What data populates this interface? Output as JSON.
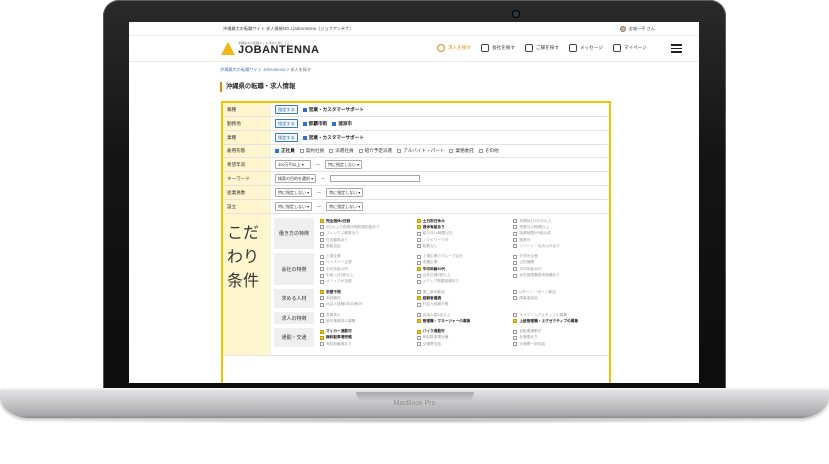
{
  "laptop": {
    "brand": "MacBook Pro"
  },
  "topbar": {
    "tagline": "沖縄最大の転職サイト 求人情報NO.1|JobAntenna（ジョブアンテナ）",
    "user_name": "金城一平 さん"
  },
  "header": {
    "logo_tag": "沖縄最大の転職サイト あなた探してる…",
    "logo_name": "JOBANTENNA",
    "nav": [
      {
        "label": "求人を探す",
        "icon": "search-icon",
        "active": true
      },
      {
        "label": "会社を探す",
        "icon": "building-icon",
        "active": false
      },
      {
        "label": "ご縁を探す",
        "icon": "handshake-icon",
        "active": false
      },
      {
        "label": "メッセージ",
        "icon": "message-icon",
        "active": false
      },
      {
        "label": "マイページ",
        "icon": "mypage-icon",
        "active": false
      }
    ]
  },
  "breadcrumb": {
    "home": "沖縄最大の転職サイト JobAntenna",
    "separator": ">",
    "current": "求人を探す"
  },
  "title": "沖縄県の転職・求人情報",
  "form": {
    "pick_label": "指定する",
    "rows": {
      "shokushu": {
        "label": "職種",
        "checks": [
          "営業・カスタマーサポート"
        ]
      },
      "kinmuchi": {
        "label": "勤務地",
        "checks": [
          "那覇市街",
          "浦添市"
        ]
      },
      "gyoshu": {
        "label": "業種",
        "checks": [
          "営業・カスタマーサポート"
        ]
      },
      "koyo": {
        "label": "雇用形態",
        "options": [
          "正社員",
          "契約社員",
          "派遣社員",
          "紹介予定派遣",
          "アルバイト・パート",
          "業務委託",
          "その他"
        ],
        "checked": [
          0
        ]
      },
      "nenshu": {
        "label": "希望年収",
        "from": "300万円以上",
        "tilde": "〜",
        "to": "特に指定しない"
      },
      "keyword": {
        "label": "キーワード",
        "scope": "検索の目的を選択",
        "tilde": "〜"
      },
      "jugyoin": {
        "label": "従業員数",
        "from": "特に指定しない",
        "tilde": "〜",
        "to": "特に指定しない"
      },
      "setsuritsu": {
        "label": "設立",
        "from": "特に指定しない",
        "tilde": "〜",
        "to": "特に指定しない"
      }
    },
    "kodawari": {
      "label": "こだわり条件",
      "groups": [
        {
          "label": "働き方の特徴",
          "options": [
            {
              "text": "完全週休2日制",
              "on": true
            },
            {
              "text": "土日祝日休み",
              "on": true
            },
            {
              "text": "年間休日120日以上",
              "on": false
            },
            {
              "text": "5日以上の長期休暇取得制度あり",
              "on": false
            },
            {
              "text": "週休有給あり",
              "on": true
            },
            {
              "text": "残業月10時間以上",
              "on": false
            },
            {
              "text": "フレックス勤務あり",
              "on": false
            },
            {
              "text": "給与月10時間以内",
              "on": false
            },
            {
              "text": "始業時間が9時以前",
              "on": false
            },
            {
              "text": "在宅勤務あり",
              "on": false
            },
            {
              "text": "ノマドワーク可",
              "on": false
            },
            {
              "text": "副業可",
              "on": false
            },
            {
              "text": "服装自由",
              "on": false
            },
            {
              "text": "転勤なし",
              "on": false
            },
            {
              "text": "リゾート・住み込みあり",
              "on": false
            }
          ]
        },
        {
          "label": "会社の特徴",
          "options": [
            {
              "text": "上場企業",
              "on": false
            },
            {
              "text": "上場企業のグループ会社",
              "on": false
            },
            {
              "text": "外資系企業",
              "on": false
            },
            {
              "text": "ベンチャー企業",
              "on": false
            },
            {
              "text": "老舗企業",
              "on": false
            },
            {
              "text": "公的機関",
              "on": false
            },
            {
              "text": "平均年齢20代",
              "on": false
            },
            {
              "text": "平均年齢30代",
              "on": true
            },
            {
              "text": "平均年齢40代",
              "on": false
            },
            {
              "text": "中途入社5割以上",
              "on": false
            },
            {
              "text": "女性社員5割以上",
              "on": false
            },
            {
              "text": "女性管理職登用実績あり",
              "on": false
            },
            {
              "text": "オフィスが自慢",
              "on": false
            },
            {
              "text": "メディア掲載実績あり",
              "on": false
            }
          ]
        },
        {
          "label": "求める人材",
          "options": [
            {
              "text": "学歴不問",
              "on": true
            },
            {
              "text": "第二新卒歓迎",
              "on": false
            },
            {
              "text": "Uターン・Iターン歓迎",
              "on": false
            },
            {
              "text": "未経験可",
              "on": false
            },
            {
              "text": "経験者優遇",
              "on": true
            },
            {
              "text": "障害者採用",
              "on": false
            },
            {
              "text": "社会人経験3年未満OK",
              "on": false
            },
            {
              "text": "社会人経験不問",
              "on": false
            }
          ]
        },
        {
          "label": "求人の特徴",
          "options": [
            {
              "text": "急募求人",
              "on": false
            },
            {
              "text": "採用人数2名以上",
              "on": false
            },
            {
              "text": "オープニングスタッフの募集",
              "on": false
            },
            {
              "text": "新卒事業部の募集",
              "on": false
            },
            {
              "text": "管理職・マネージャーの募集",
              "on": true
            },
            {
              "text": "上級管理職・エグゼクティブの募集",
              "on": true
            }
          ]
        },
        {
          "label": "通勤・交通",
          "options": [
            {
              "text": "マイカー通勤可",
              "on": true
            },
            {
              "text": "バイク通勤可",
              "on": true
            },
            {
              "text": "自転車通勤可",
              "on": false
            },
            {
              "text": "無料駐車場完備",
              "on": true
            },
            {
              "text": "有料駐車場完備",
              "on": false
            },
            {
              "text": "社員寮あり",
              "on": false
            },
            {
              "text": "有料駐輪場あり",
              "on": false
            },
            {
              "text": "交通費支給",
              "on": false
            },
            {
              "text": "交通費一部支給",
              "on": false
            }
          ]
        }
      ]
    }
  }
}
